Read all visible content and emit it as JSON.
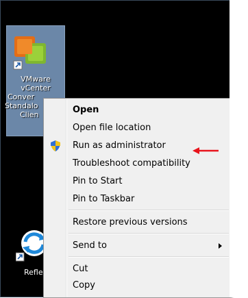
{
  "desktop": {
    "selected_icon": {
      "label_lines": [
        "VMware",
        "vCenter",
        "Conver",
        "Standalo",
        "Clien"
      ],
      "icon": "vmware-converter-icon"
    },
    "second_icon": {
      "label": "Reflec",
      "icon": "reflect-icon"
    }
  },
  "context_menu": {
    "items": [
      {
        "label": "Open",
        "bold": true
      },
      {
        "label": "Open file location"
      },
      {
        "label": "Run as administrator",
        "icon": "uac-shield-icon"
      },
      {
        "label": "Troubleshoot compatibility"
      },
      {
        "label": "Pin to Start"
      },
      {
        "label": "Pin to Taskbar"
      },
      {
        "label": "Restore previous versions"
      },
      {
        "label": "Send to",
        "submenu": true
      },
      {
        "label": "Cut"
      },
      {
        "label": "Copy"
      }
    ]
  },
  "annotation": {
    "arrow_color": "#e8141c",
    "points_to": "Run as administrator"
  },
  "colors": {
    "menu_background": "#f0f0f0",
    "selection_tile": "#6b87a8",
    "desktop": "#000000"
  }
}
